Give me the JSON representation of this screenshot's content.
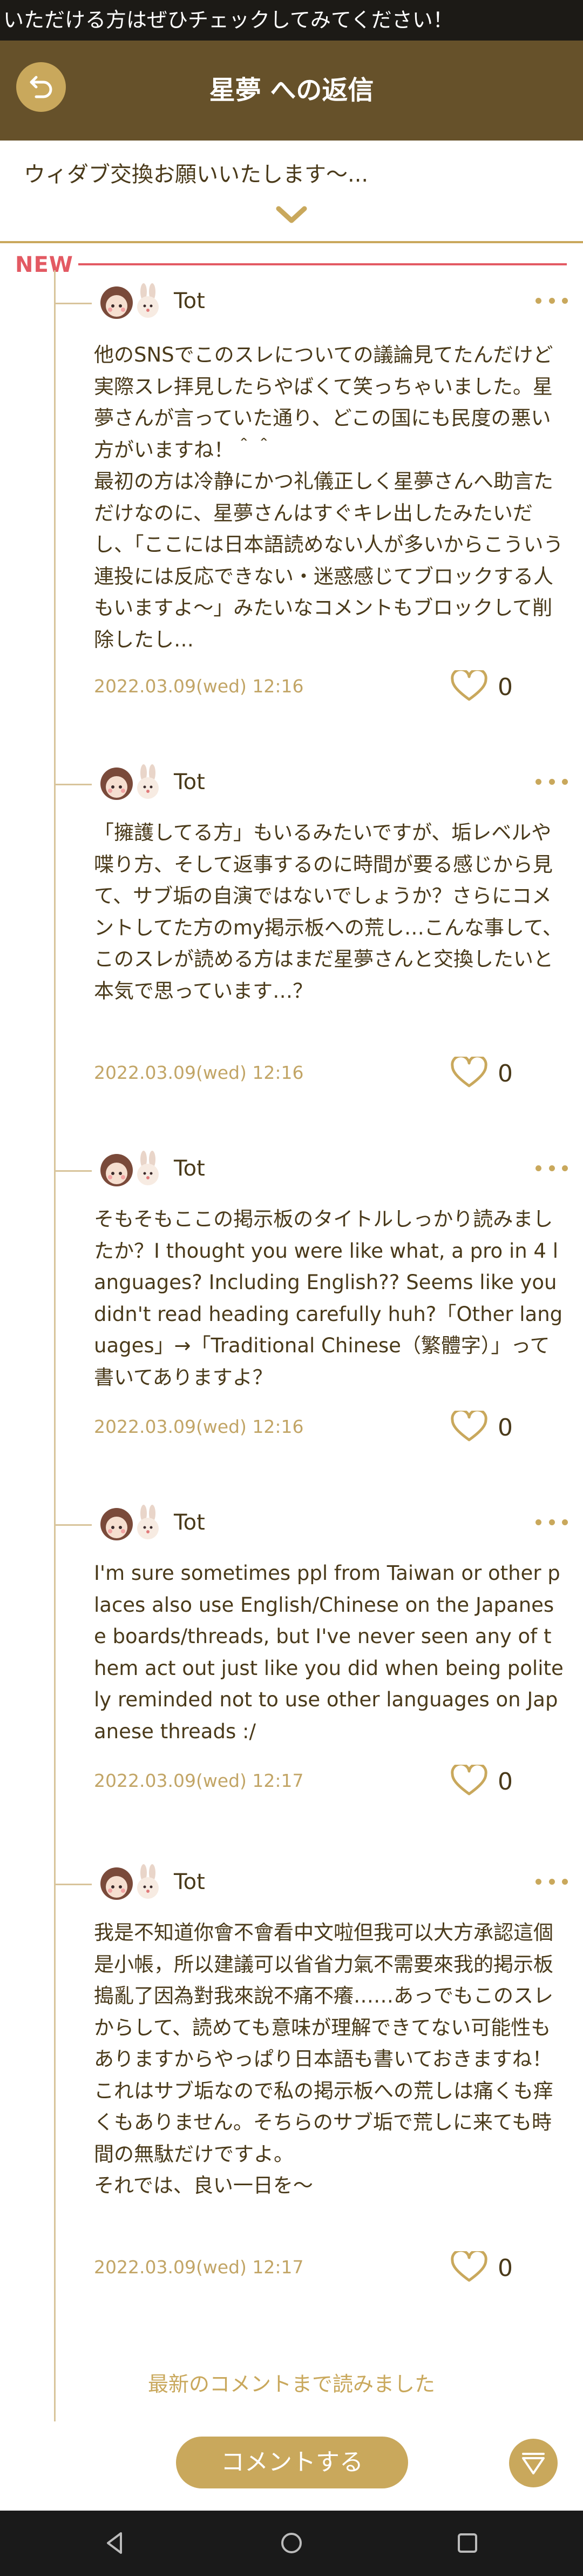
{
  "ticker": {
    "text": "いただける方はぜひチェックしてみてください！"
  },
  "header": {
    "title": "星夢 への返信"
  },
  "original_post": {
    "text": "ウィダブ交換お願いいたします〜..."
  },
  "new_label": "NEW",
  "colors": {
    "accent": "#c9a85c",
    "header_bg": "#66512a",
    "new": "#e35a63",
    "text": "#4a3a1a"
  },
  "comments": [
    {
      "username": "Tot",
      "text": "他のSNSでこのスレについての議論見てたんだけど実際スレ拝見したらやばくて笑っちゃいました。星夢さんが言っていた通り、どこの国にも民度の悪い方がいますね！＾＾\n最初の方は冷静にかつ礼儀正しく星夢さんへ助言ただけなのに、星夢さんはすぐキレ出したみたいだし、「ここには日本語読めない人が多いからこういう連投には反応できない・迷惑感じてブロックする人もいますよ〜」みたいなコメントもブロックして削除したし…",
      "timestamp": "2022.03.09(wed) 12:16",
      "likes": "0"
    },
    {
      "username": "Tot",
      "text": "「擁護してる方」もいるみたいですが、垢レベルや喋り方、そして返事するのに時間が要る感じから見て、サブ垢の自演ではないでしょうか？さらにコメントしてた方のmy掲示板への荒し…こんな事して、このスレが読める方はまだ星夢さんと交換したいと本気で思っています…？",
      "timestamp": "2022.03.09(wed) 12:16",
      "likes": "0"
    },
    {
      "username": "Tot",
      "text": "そもそもここの掲示板のタイトルしっかり読みましたか？I thought you were like what, a pro in 4 languages? Including English?? Seems like you didn't read heading carefully huh?「Other languages」→「Traditional Chinese（繁體字）」って書いてありますよ？",
      "timestamp": "2022.03.09(wed) 12:16",
      "likes": "0"
    },
    {
      "username": "Tot",
      "text": "I'm sure sometimes ppl from Taiwan or other places also use English/Chinese on the Japanese boards/threads, but I've never seen any of them act out just like you did when being politely reminded not to use other languages on Japanese threads :/",
      "timestamp": "2022.03.09(wed) 12:17",
      "likes": "0"
    },
    {
      "username": "Tot",
      "text": "我是不知道你會不會看中文啦但我可以大方承認這個是小帳，所以建議可以省省力氣不需要來我的掲示板搗亂了因為對我來說不痛不癢……あっでもこのスレからして、読めても意味が理解できてない可能性もありますからやっぱり日本語も書いておきますね！これはサブ垢なので私の掲示板への荒しは痛くも痒くもありません。そちらのサブ垢で荒しに来ても時間の無駄だけですよ。\nそれでは、良い一日を〜",
      "timestamp": "2022.03.09(wed) 12:17",
      "likes": "0"
    }
  ],
  "footer": {
    "read_all": "最新のコメントまで読みました",
    "comment_button": "コメントする"
  }
}
